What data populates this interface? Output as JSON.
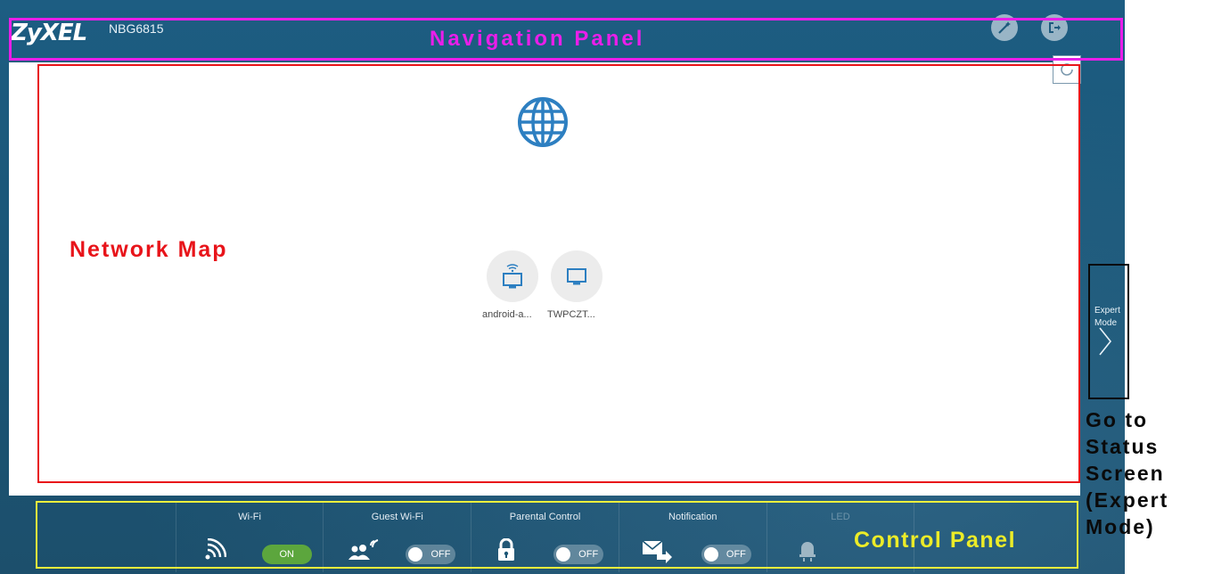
{
  "nav": {
    "logo": "ZyXEL",
    "model": "NBG6815",
    "buttons": [
      "wizard-icon",
      "logout-icon"
    ]
  },
  "network_map": {
    "devices": [
      {
        "label": "android-a...",
        "icon": "monitor-wifi-icon"
      },
      {
        "label": "TWPCZT...",
        "icon": "monitor-icon"
      }
    ]
  },
  "expert": {
    "label_line1": "Expert",
    "label_line2": "Mode"
  },
  "control_panel": {
    "wifi": {
      "label": "Wi-Fi",
      "state": "ON"
    },
    "guest_wifi": {
      "label": "Guest Wi-Fi",
      "state": "OFF"
    },
    "parental_control": {
      "label": "Parental Control",
      "state": "OFF"
    },
    "notification": {
      "label": "Notification",
      "state": "OFF"
    },
    "led": {
      "label": "LED"
    }
  },
  "annotations": {
    "navigation_panel": "Navigation Panel",
    "network_map": "Network Map",
    "control_panel": "Control Panel",
    "go_to_status": "Go to Status Screen (Expert Mode)"
  },
  "colors": {
    "nav_annotation": "#e81ee8",
    "map_annotation": "#e8141a",
    "control_annotation": "#f0f03c",
    "expert_annotation": "#0a0a0a",
    "accent": "#2d7fc1",
    "on_toggle": "#5ca63d"
  }
}
